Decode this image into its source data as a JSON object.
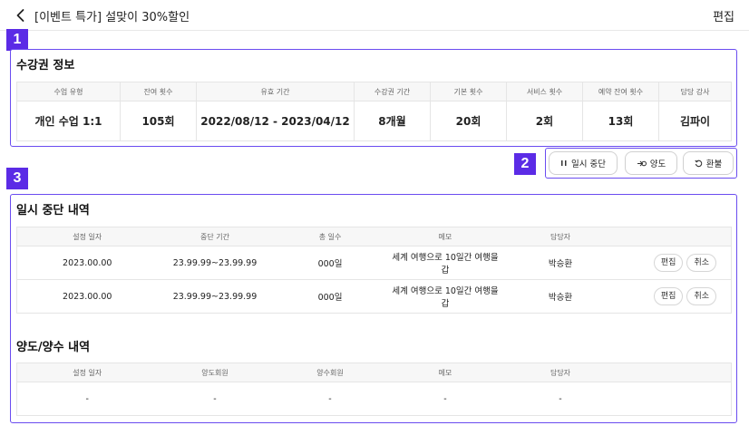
{
  "header": {
    "title": "[이벤트 특가] 설맞이 30%할인",
    "edit_label": "편집"
  },
  "markers": [
    "1",
    "2",
    "3"
  ],
  "ticket_info": {
    "title": "수강권 정보",
    "columns": [
      "수업 유형",
      "잔여 횟수",
      "유효 기간",
      "수강권 기간",
      "기본 횟수",
      "서비스 횟수",
      "예약 잔여 횟수",
      "담당 강사"
    ],
    "values": [
      "개인 수업 1:1",
      "105회",
      "2022/08/12 - 2023/04/12",
      "8개월",
      "20회",
      "2회",
      "13회",
      "김파이"
    ]
  },
  "actions": {
    "pause_label": "일시 중단",
    "transfer_label": "양도",
    "refund_label": "환불"
  },
  "pause_history": {
    "title": "일시 중단 내역",
    "columns": [
      "설정 일자",
      "중단 기간",
      "총 일수",
      "메모",
      "담당자",
      ""
    ],
    "rows": [
      {
        "date": "2023.00.00",
        "period": "23.99.99~23.99.99",
        "days": "000일",
        "memo": "세계 여행으로 10일간 여행을 갑",
        "manager": "박승환",
        "edit_label": "편집",
        "cancel_label": "취소"
      },
      {
        "date": "2023.00.00",
        "period": "23.99.99~23.99.99",
        "days": "000일",
        "memo": "세계 여행으로 10일간 여행을 갑",
        "manager": "박승환",
        "edit_label": "편집",
        "cancel_label": "취소"
      }
    ]
  },
  "transfer_history": {
    "title": "양도/양수 내역",
    "columns": [
      "설정 일자",
      "양도회원",
      "양수회원",
      "메모",
      "담당자",
      ""
    ],
    "rows": [
      {
        "date": "-",
        "from": "-",
        "to": "-",
        "memo": "-",
        "manager": "-"
      }
    ]
  },
  "colors": {
    "accent": "#5b2be6",
    "panel_border": "#6a4cf0"
  }
}
